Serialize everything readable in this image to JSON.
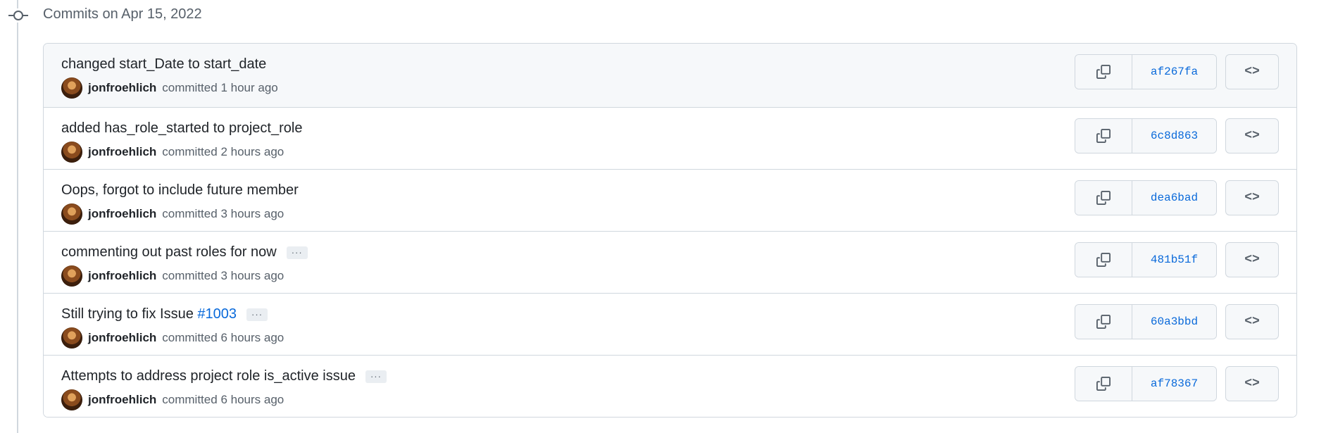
{
  "date_header": "Commits on Apr 15, 2022",
  "commits": [
    {
      "title": "changed start_Date to start_date",
      "issue": "",
      "has_more": false,
      "author": "jonfroehlich",
      "action": "committed",
      "time": "1 hour ago",
      "sha": "af267fa"
    },
    {
      "title": "added has_role_started to project_role",
      "issue": "",
      "has_more": false,
      "author": "jonfroehlich",
      "action": "committed",
      "time": "2 hours ago",
      "sha": "6c8d863"
    },
    {
      "title": "Oops, forgot to include future member",
      "issue": "",
      "has_more": false,
      "author": "jonfroehlich",
      "action": "committed",
      "time": "3 hours ago",
      "sha": "dea6bad"
    },
    {
      "title": "commenting out past roles for now",
      "issue": "",
      "has_more": true,
      "author": "jonfroehlich",
      "action": "committed",
      "time": "3 hours ago",
      "sha": "481b51f"
    },
    {
      "title": "Still trying to fix Issue ",
      "issue": "#1003",
      "has_more": true,
      "author": "jonfroehlich",
      "action": "committed",
      "time": "6 hours ago",
      "sha": "60a3bbd"
    },
    {
      "title": "Attempts to address project role is_active issue",
      "issue": "",
      "has_more": true,
      "author": "jonfroehlich",
      "action": "committed",
      "time": "6 hours ago",
      "sha": "af78367"
    }
  ],
  "ellipsis_label": "···",
  "browse_label": "<>",
  "icons": {
    "timeline": "git-commit-icon",
    "copy": "copy-icon",
    "browse": "code-icon"
  },
  "colors": {
    "link": "#0969da",
    "muted": "#57606a",
    "border": "#d0d7de"
  }
}
